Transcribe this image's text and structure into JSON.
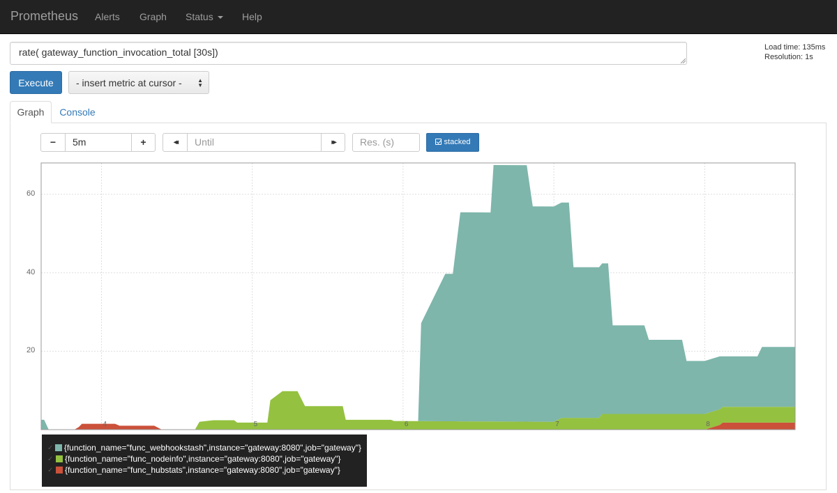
{
  "navbar": {
    "brand": "Prometheus",
    "items": [
      {
        "label": "Alerts"
      },
      {
        "label": "Graph"
      },
      {
        "label": "Status"
      },
      {
        "label": "Help"
      }
    ]
  },
  "query": {
    "expression": "rate( gateway_function_invocation_total [30s])",
    "load_time": "Load time: 135ms",
    "resolution": "Resolution: 1s",
    "execute_label": "Execute",
    "metric_select": "- insert metric at cursor -"
  },
  "tabs": [
    {
      "label": "Graph",
      "active": true
    },
    {
      "label": "Console",
      "active": false
    }
  ],
  "controls": {
    "minus": "−",
    "range": "5m",
    "plus": "+",
    "back": "◂◂",
    "until_placeholder": "Until",
    "forward": "▸▸",
    "res_placeholder": "Res. (s)",
    "stacked_label": "stacked"
  },
  "chart_data": {
    "type": "area",
    "stacked": true,
    "grid": true,
    "xlim": [
      3.6,
      8.6
    ],
    "ylim": [
      0,
      68
    ],
    "x_ticks": [
      "4",
      "5",
      "6",
      "7",
      "8"
    ],
    "y_ticks": [
      "20",
      "40",
      "60"
    ],
    "legend_position": "bottom-left",
    "series": [
      {
        "name": "{function_name=\"func_hubstats\",instance=\"gateway:8080\",job=\"gateway\"}",
        "color": "#cb513a",
        "x": [
          3.6,
          3.82,
          3.85,
          3.87,
          4.09,
          4.12,
          4.35,
          4.4,
          8.0,
          8.1,
          8.12,
          8.6
        ],
        "y": [
          0,
          0,
          0.7,
          1.5,
          1.5,
          1.0,
          1.0,
          0,
          0,
          1.2,
          1.8,
          1.8
        ]
      },
      {
        "name": "{function_name=\"func_nodeinfo\",instance=\"gateway:8080\",job=\"gateway\"}",
        "color": "#94c140",
        "x": [
          3.6,
          4.62,
          4.65,
          4.74,
          4.88,
          4.9,
          5.0,
          5.1,
          5.12,
          5.2,
          5.3,
          5.35,
          5.6,
          5.62,
          5.92,
          5.94,
          7.0,
          7.05,
          7.3,
          7.32,
          8.1,
          8.12,
          8.6
        ],
        "y": [
          0,
          0,
          2.0,
          2.4,
          2.4,
          1.8,
          1.8,
          1.8,
          7.5,
          9.8,
          9.8,
          6.0,
          6.0,
          2.5,
          2.5,
          2.2,
          2.0,
          3.0,
          3.0,
          4.0,
          4.0,
          4.0,
          4.0
        ]
      },
      {
        "name": "{function_name=\"func_webhookstash\",instance=\"gateway:8080\",job=\"gateway\"}",
        "color": "#7eb6ab",
        "x": [
          3.6,
          3.62,
          3.65,
          6.1,
          6.12,
          6.28,
          6.33,
          6.38,
          6.58,
          6.6,
          6.82,
          6.86,
          7.1,
          7.13,
          7.36,
          7.39,
          7.6,
          7.63,
          7.85,
          7.88,
          8.1,
          8.12,
          8.35,
          8.38,
          8.6
        ],
        "y": [
          2.5,
          2.5,
          0,
          0,
          25,
          37.6,
          37.6,
          53.3,
          53.3,
          65.4,
          65.4,
          54.9,
          54.9,
          38.4,
          38.4,
          22.6,
          22.6,
          18.9,
          18.9,
          13.5,
          13.5,
          12.9,
          12.9,
          15.3,
          15.3
        ]
      }
    ]
  }
}
